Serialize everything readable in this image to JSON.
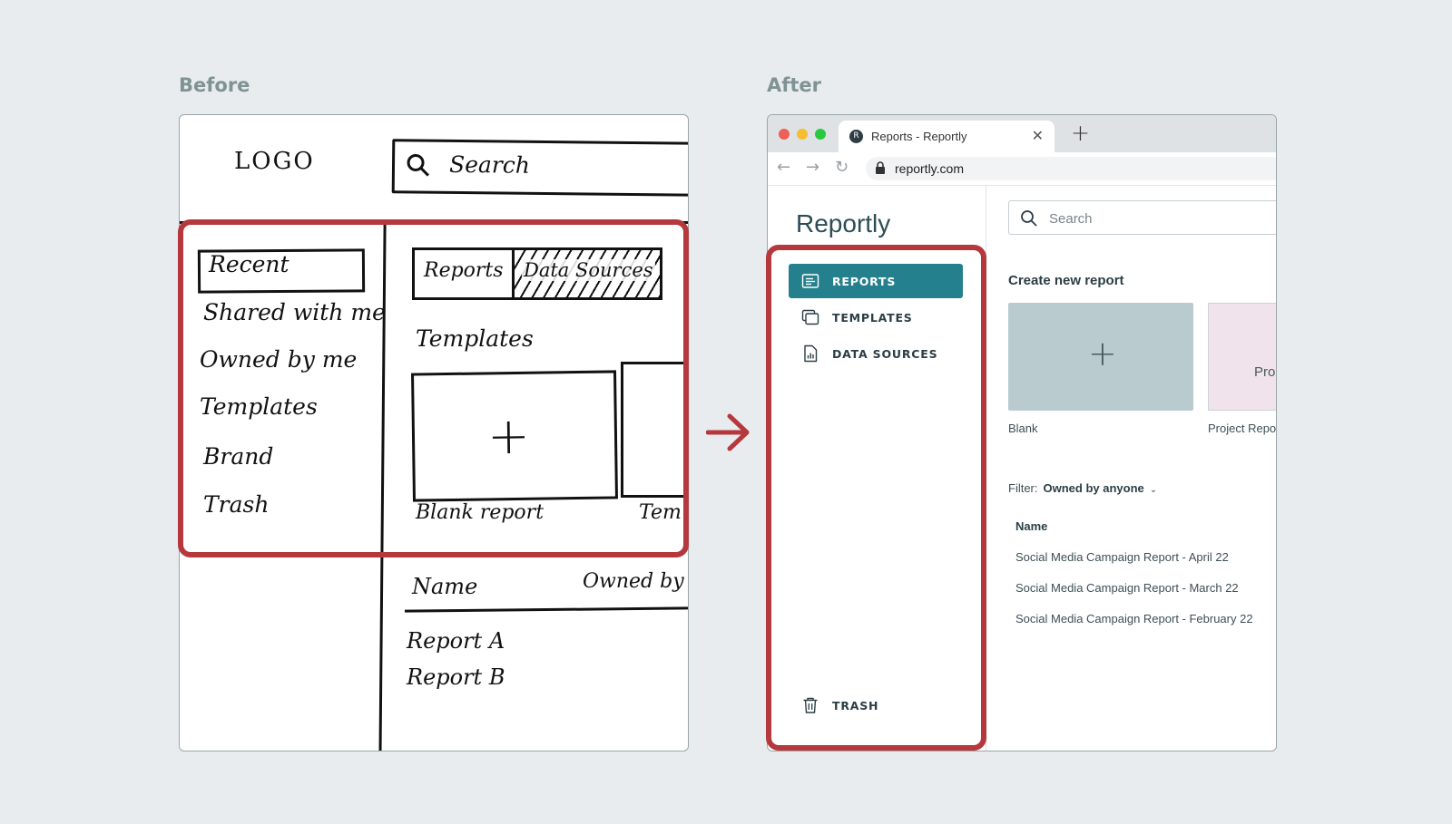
{
  "labels": {
    "before": "Before",
    "after": "After"
  },
  "sketch": {
    "logo": "LOGO",
    "search": "Search",
    "nav": [
      "Recent",
      "Shared with me",
      "Owned by me",
      "Templates",
      "Brand",
      "Trash"
    ],
    "tabs": [
      "Reports",
      "Data Sources"
    ],
    "templates_heading": "Templates",
    "cards": [
      "Blank report",
      "Tem"
    ],
    "columns": [
      "Name",
      "Owned by"
    ],
    "rows": [
      "Report A",
      "Report B"
    ]
  },
  "browser": {
    "tab_favicon": "R",
    "tab_title": "Reports - Reportly",
    "url": "reportly.com"
  },
  "app": {
    "brand": "Reportly",
    "nav": [
      {
        "label": "REPORTS",
        "icon": "reports-icon",
        "active": true
      },
      {
        "label": "TEMPLATES",
        "icon": "templates-icon",
        "active": false
      },
      {
        "label": "DATA SOURCES",
        "icon": "data-sources-icon",
        "active": false
      }
    ],
    "trash": {
      "label": "TRASH",
      "icon": "trash-icon"
    },
    "search_placeholder": "Search",
    "create_title": "Create new report",
    "cards": [
      {
        "label": "Blank"
      },
      {
        "label": "Project Repo",
        "thumb_text": "Pro"
      }
    ],
    "filter": {
      "label": "Filter:",
      "value": "Owned by anyone"
    },
    "table": {
      "header": "Name",
      "rows": [
        "Social Media Campaign Report - April 22",
        "Social Media Campaign Report - March 22",
        "Social Media Campaign Report - February 22"
      ]
    }
  },
  "colors": {
    "accent": "#25808e",
    "highlight": "#b5383c",
    "brand_text": "#2c4d55"
  }
}
